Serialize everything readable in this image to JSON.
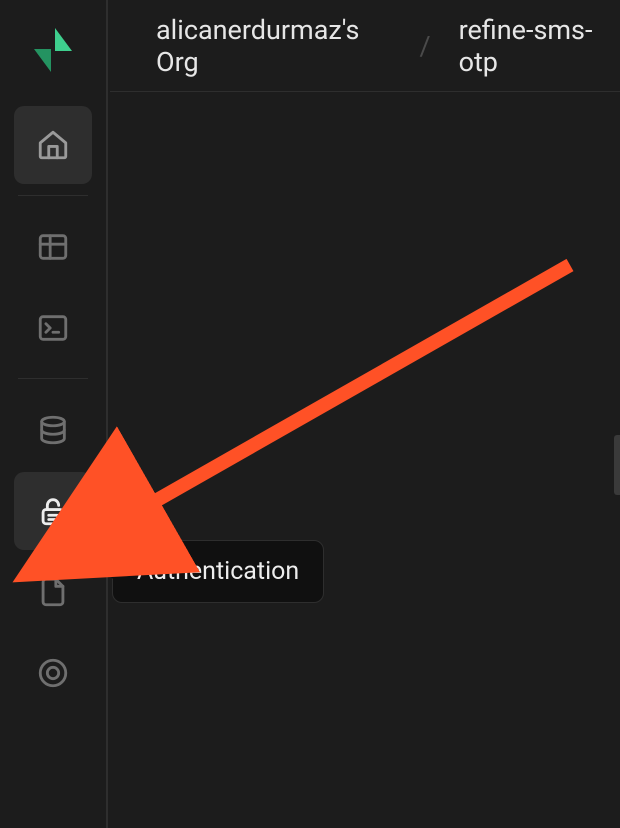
{
  "breadcrumb": {
    "org": "alicanerdurmaz's Org",
    "project": "refine-sms-otp"
  },
  "sidebar": {
    "items": [
      {
        "id": "home",
        "icon": "home-icon"
      },
      {
        "id": "table-editor",
        "icon": "table-icon"
      },
      {
        "id": "sql-editor",
        "icon": "terminal-icon"
      },
      {
        "id": "database",
        "icon": "database-icon"
      },
      {
        "id": "authentication",
        "icon": "lock-icon"
      },
      {
        "id": "storage",
        "icon": "file-icon"
      },
      {
        "id": "edge-functions",
        "icon": "circle-icon"
      }
    ]
  },
  "tooltip": {
    "label": "Authentication"
  },
  "colors": {
    "accent": "#3ecf8e",
    "arrow": "#ff5126"
  }
}
